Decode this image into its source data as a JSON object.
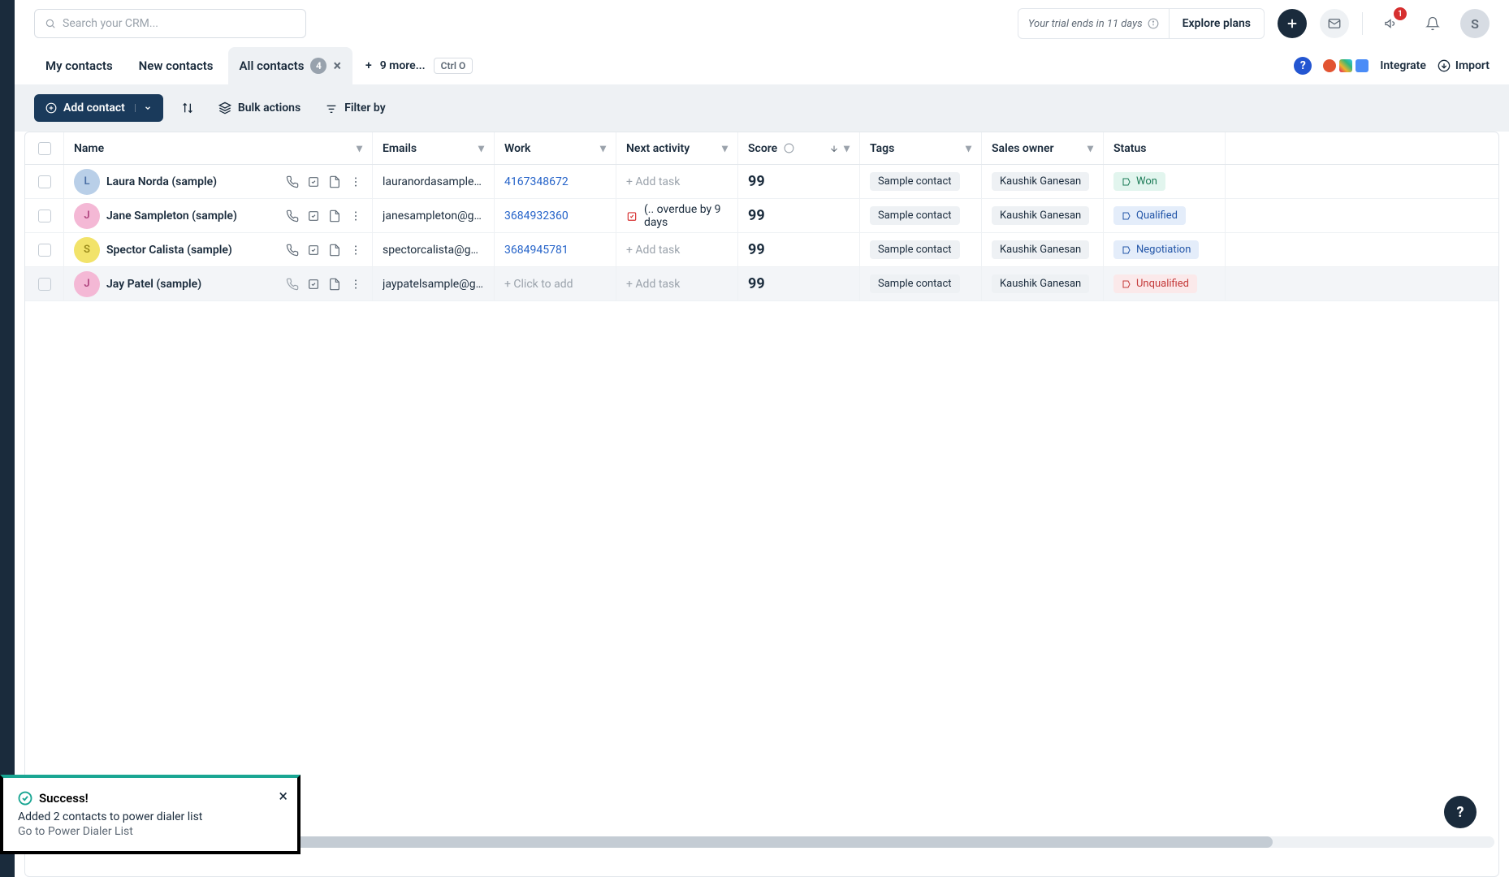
{
  "header": {
    "search_placeholder": "Search your CRM...",
    "trial_text": "Your trial ends in 11 days",
    "explore": "Explore plans",
    "notif_count": "1",
    "avatar_letter": "S"
  },
  "tabs": {
    "items": [
      {
        "label": "My contacts"
      },
      {
        "label": "New contacts"
      },
      {
        "label": "All contacts",
        "count": "4",
        "active": true
      }
    ],
    "more": "9 more...",
    "kbd": "Ctrl O",
    "integrate": "Integrate",
    "import": "Import"
  },
  "toolbar": {
    "add_contact": "Add contact",
    "bulk_actions": "Bulk actions",
    "filter_by": "Filter by"
  },
  "columns": {
    "name": "Name",
    "emails": "Emails",
    "work": "Work",
    "next": "Next activity",
    "score": "Score",
    "tags": "Tags",
    "owner": "Sales owner",
    "status": "Status"
  },
  "rows": [
    {
      "initial": "L",
      "avatar_bg": "#b9cfe8",
      "avatar_fg": "#4a6fa5",
      "name": "Laura Norda (sample)",
      "email": "lauranordasample@g...",
      "work": "4167348672",
      "next_type": "add",
      "next_text": "+ Add task",
      "score": "99",
      "tag": "Sample contact",
      "owner": "Kaushik Ganesan",
      "status": "Won",
      "status_class": "status-won"
    },
    {
      "initial": "J",
      "avatar_bg": "#f4b8d5",
      "avatar_fg": "#b0457f",
      "name": "Jane Sampleton (sample)",
      "email": "janesampleton@gmail...",
      "work": "3684932360",
      "next_type": "overdue",
      "next_text": "(.. overdue by 9 days",
      "score": "99",
      "tag": "Sample contact",
      "owner": "Kaushik Ganesan",
      "status": "Qualified",
      "status_class": "status-qualified"
    },
    {
      "initial": "S",
      "avatar_bg": "#f2e36a",
      "avatar_fg": "#9b8b1b",
      "name": "Spector Calista (sample)",
      "email": "spectorcalista@gmail....",
      "work": "3684945781",
      "next_type": "add",
      "next_text": "+ Add task",
      "score": "99",
      "tag": "Sample contact",
      "owner": "Kaushik Ganesan",
      "status": "Negotiation",
      "status_class": "status-negotiation"
    },
    {
      "initial": "J",
      "avatar_bg": "#f4b8d5",
      "avatar_fg": "#b0457f",
      "name": "Jay Patel (sample)",
      "email": "jaypatelsample@gmail...",
      "work": "+ Click to add",
      "work_muted": true,
      "next_type": "add",
      "next_text": "+ Add task",
      "score": "99",
      "tag": "Sample contact",
      "owner": "Kaushik Ganesan",
      "status": "Unqualified",
      "status_class": "status-unqualified",
      "active": true
    }
  ],
  "toast": {
    "title": "Success!",
    "msg": "Added 2 contacts to power dialer list",
    "link": "Go to Power Dialer List"
  }
}
